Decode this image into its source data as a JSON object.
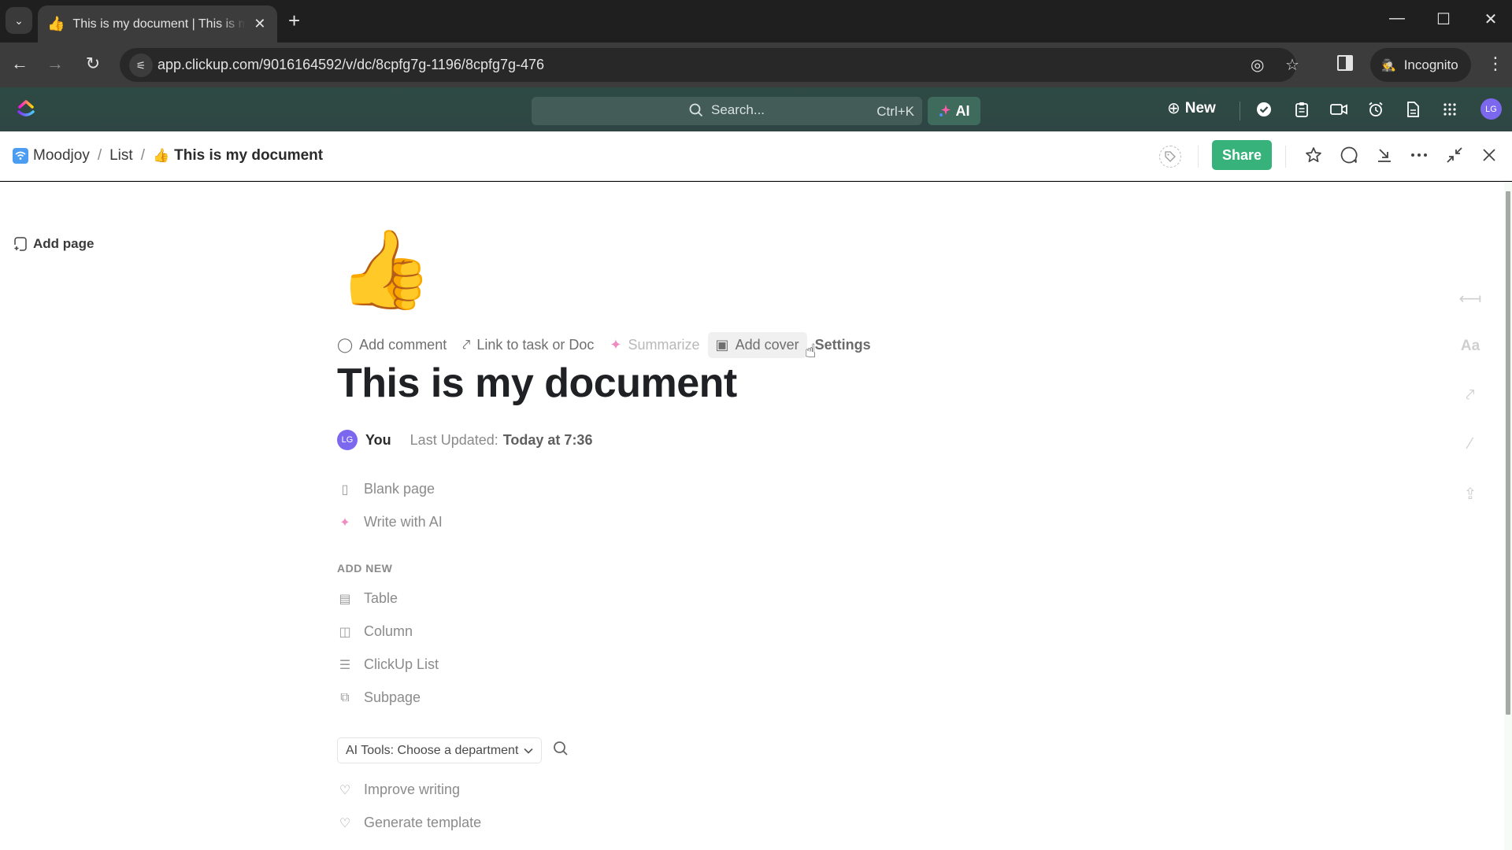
{
  "browser": {
    "tab": {
      "favicon": "👍",
      "title": "This is my document | This is my document",
      "close": "✕"
    },
    "tab_list_icon": "⌄",
    "new_tab": "+",
    "window": {
      "minimize": "—",
      "maximize": "☐",
      "close": "✕"
    },
    "nav": {
      "back": "←",
      "forward": "→",
      "reload": "↻"
    },
    "url": "app.clickup.com/9016164592/v/dc/8cpfg7g-1196/8cpfg7g-476",
    "site_info_icon": "⚟",
    "eye_off_icon": "◎",
    "bookmark_icon": "☆",
    "incognito_label": "Incognito",
    "incognito_icon": "🕵",
    "menu_icon": "⋮"
  },
  "topbar": {
    "search_placeholder": "Search...",
    "search_shortcut": "Ctrl+K",
    "ai_label": "AI",
    "new_label": "New",
    "new_icon": "⊕",
    "icons": [
      "check-circle",
      "clipboard",
      "video",
      "alarm",
      "document",
      "apps-grid"
    ],
    "avatar_initials": "LG"
  },
  "header": {
    "breadcrumb": [
      {
        "label": "Moodjoy",
        "icon": "wifi-space-icon"
      },
      {
        "label": "List"
      },
      {
        "label": "This is my document",
        "emoji": "👍"
      }
    ],
    "separator": "/",
    "share_label": "Share",
    "tag_icon": "⌂"
  },
  "sidebar": {
    "add_page_label": "Add page"
  },
  "doc": {
    "emoji": "👍",
    "actions": [
      {
        "label": "Add comment",
        "icon": "comment-icon",
        "glyph": "◯"
      },
      {
        "label": "Link to task or Doc",
        "icon": "link-icon",
        "glyph": "⤤"
      },
      {
        "label": "Summarize",
        "icon": "sparkle-icon",
        "glyph": "✦"
      },
      {
        "label": "Add cover",
        "icon": "image-icon",
        "glyph": "▣"
      },
      {
        "label": "Settings"
      }
    ],
    "title": "This is my document",
    "author_initials": "LG",
    "author": "You",
    "last_updated_label": "Last Updated:",
    "last_updated_value": "Today at 7:36",
    "start_options": [
      {
        "label": "Blank page",
        "glyph": "▯"
      },
      {
        "label": "Write with AI",
        "glyph": "✦"
      }
    ],
    "add_new_label": "ADD NEW",
    "add_new_items": [
      {
        "label": "Table",
        "glyph": "▤"
      },
      {
        "label": "Column",
        "glyph": "◫"
      },
      {
        "label": "ClickUp List",
        "glyph": "☰"
      },
      {
        "label": "Subpage",
        "glyph": "⧉"
      }
    ],
    "ai_tools_select": "AI Tools: Choose a department",
    "ai_tools_items": [
      {
        "label": "Improve writing",
        "glyph": "♡"
      },
      {
        "label": "Generate template",
        "glyph": "♡"
      }
    ]
  },
  "right_rail": [
    "collapse-icon",
    "font-icon",
    "link-icon",
    "magic-wand-icon",
    "export-icon"
  ],
  "colors": {
    "brand_green": "#37b27b",
    "topbar": "#2f4844",
    "avatar": "#7b68ee"
  }
}
